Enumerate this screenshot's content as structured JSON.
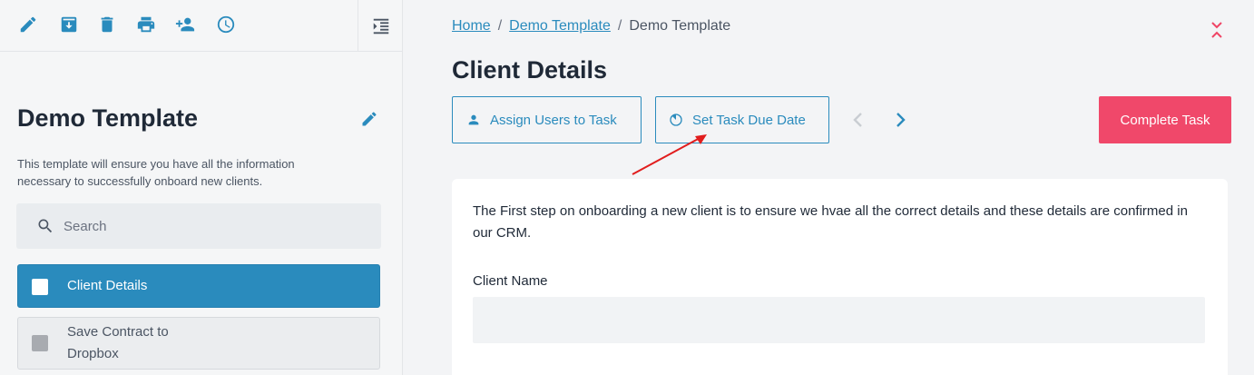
{
  "toolbar": {
    "tools": [
      "pencil-icon",
      "archive-icon",
      "trash-icon",
      "print-icon",
      "add-user-icon",
      "clock-icon"
    ],
    "collapse_icon": "collapse-sidebar-icon"
  },
  "sidebar": {
    "title": "Demo Template",
    "description": "This template will ensure you have all the information necessary to successfully onboard new clients.",
    "search_placeholder": "Search",
    "tasks": [
      {
        "label": "Client Details",
        "active": true
      },
      {
        "label": "Save Contract to Dropbox",
        "active": false
      }
    ]
  },
  "breadcrumb": {
    "items": [
      "Home",
      "Demo Template",
      "Demo Template"
    ]
  },
  "main": {
    "title": "Client Details",
    "assign_label": "Assign Users to Task",
    "due_date_label": "Set Task Due Date",
    "complete_label": "Complete Task",
    "intro": "The First step on onboarding a new client is to ensure we hvae all the correct details and these details are confirmed in our CRM.",
    "field_label": "Client Name",
    "field_value": ""
  },
  "colors": {
    "accent": "#2a8bbd",
    "danger": "#f0486a",
    "annotation": "#e11d1d"
  }
}
